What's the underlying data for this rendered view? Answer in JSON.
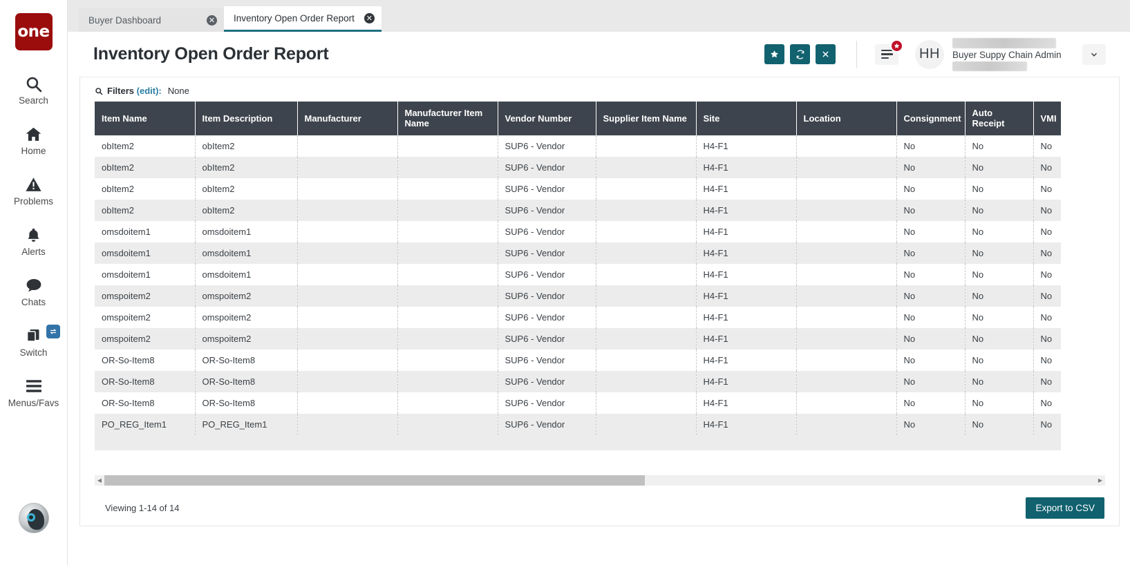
{
  "brand": {
    "logo_text": "one",
    "logo_color": "#9b0d0d"
  },
  "sidebar": {
    "items": [
      {
        "label": "Search",
        "icon": "search-icon"
      },
      {
        "label": "Home",
        "icon": "home-icon"
      },
      {
        "label": "Problems",
        "icon": "warning-triangle-icon"
      },
      {
        "label": "Alerts",
        "icon": "bell-icon"
      },
      {
        "label": "Chats",
        "icon": "chat-bubble-icon"
      },
      {
        "label": "Switch",
        "icon": "windows-stack-icon",
        "badge_icon": "swap-arrows-icon"
      },
      {
        "label": "Menus/Favs",
        "icon": "hamburger-icon"
      }
    ],
    "bottom_avatar": "user-avatar-icon"
  },
  "tabs": [
    {
      "label": "Buyer Dashboard",
      "active": false,
      "close_icon": "close-circle-icon"
    },
    {
      "label": "Inventory Open Order Report",
      "active": true,
      "close_icon": "close-circle-icon"
    }
  ],
  "header": {
    "title": "Inventory Open Order Report",
    "actions": [
      {
        "name": "favorite-button",
        "icon": "star-icon",
        "color": "#11616f"
      },
      {
        "name": "refresh-button",
        "icon": "refresh-icon",
        "color": "#11616f"
      },
      {
        "name": "close-button",
        "icon": "x-icon",
        "color": "#11616f"
      }
    ],
    "menu_icon": "hamburger-icon",
    "menu_badge_icon": "star-icon",
    "menu_badge_color": "#c1112a",
    "avatar_initials": "HH",
    "user_role": "Buyer Suppy Chain Admin",
    "caret_icon": "chevron-down-icon"
  },
  "filters": {
    "icon": "search-icon",
    "label": "Filters",
    "edit_label": "(edit):",
    "value": "None"
  },
  "table": {
    "columns": [
      "Item Name",
      "Item Description",
      "Manufacturer",
      "Manufacturer Item Name",
      "Vendor Number",
      "Supplier Item Name",
      "Site",
      "Location",
      "Consignment",
      "Auto Receipt",
      "VMI"
    ],
    "rows": [
      [
        "obItem2",
        "obItem2",
        "",
        "",
        "SUP6 - Vendor",
        "",
        "H4-F1",
        "",
        "No",
        "No",
        "No"
      ],
      [
        "obItem2",
        "obItem2",
        "",
        "",
        "SUP6 - Vendor",
        "",
        "H4-F1",
        "",
        "No",
        "No",
        "No"
      ],
      [
        "obItem2",
        "obItem2",
        "",
        "",
        "SUP6 - Vendor",
        "",
        "H4-F1",
        "",
        "No",
        "No",
        "No"
      ],
      [
        "obItem2",
        "obItem2",
        "",
        "",
        "SUP6 - Vendor",
        "",
        "H4-F1",
        "",
        "No",
        "No",
        "No"
      ],
      [
        "omsdoitem1",
        "omsdoitem1",
        "",
        "",
        "SUP6 - Vendor",
        "",
        "H4-F1",
        "",
        "No",
        "No",
        "No"
      ],
      [
        "omsdoitem1",
        "omsdoitem1",
        "",
        "",
        "SUP6 - Vendor",
        "",
        "H4-F1",
        "",
        "No",
        "No",
        "No"
      ],
      [
        "omsdoitem1",
        "omsdoitem1",
        "",
        "",
        "SUP6 - Vendor",
        "",
        "H4-F1",
        "",
        "No",
        "No",
        "No"
      ],
      [
        "omspoitem2",
        "omspoitem2",
        "",
        "",
        "SUP6 - Vendor",
        "",
        "H4-F1",
        "",
        "No",
        "No",
        "No"
      ],
      [
        "omspoitem2",
        "omspoitem2",
        "",
        "",
        "SUP6 - Vendor",
        "",
        "H4-F1",
        "",
        "No",
        "No",
        "No"
      ],
      [
        "omspoitem2",
        "omspoitem2",
        "",
        "",
        "SUP6 - Vendor",
        "",
        "H4-F1",
        "",
        "No",
        "No",
        "No"
      ],
      [
        "OR-So-Item8",
        "OR-So-Item8",
        "",
        "",
        "SUP6 - Vendor",
        "",
        "H4-F1",
        "",
        "No",
        "No",
        "No"
      ],
      [
        "OR-So-Item8",
        "OR-So-Item8",
        "",
        "",
        "SUP6 - Vendor",
        "",
        "H4-F1",
        "",
        "No",
        "No",
        "No"
      ],
      [
        "OR-So-Item8",
        "OR-So-Item8",
        "",
        "",
        "SUP6 - Vendor",
        "",
        "H4-F1",
        "",
        "No",
        "No",
        "No"
      ],
      [
        "PO_REG_Item1",
        "PO_REG_Item1",
        "",
        "",
        "SUP6 - Vendor",
        "",
        "H4-F1",
        "",
        "No",
        "No",
        "No"
      ]
    ]
  },
  "scrollbar": {
    "left_arrow": "chevron-left-icon",
    "right_arrow": "chevron-right-icon"
  },
  "footer": {
    "viewing_text": "Viewing 1-14 of 14",
    "export_label": "Export to CSV",
    "export_color": "#11616f"
  }
}
